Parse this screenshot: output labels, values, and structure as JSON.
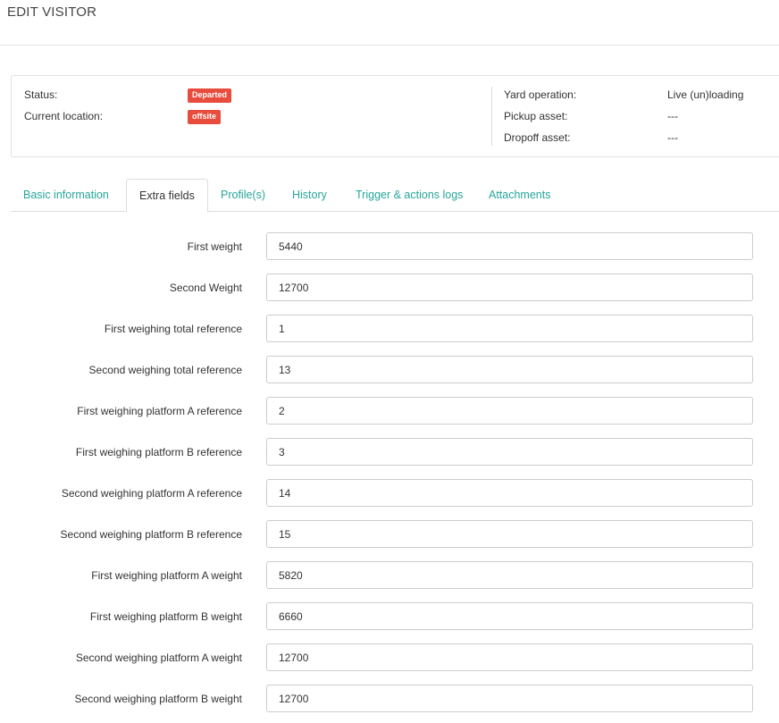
{
  "page": {
    "title": "EDIT VISITOR"
  },
  "status_card": {
    "left": [
      {
        "label": "Status:",
        "value": "Departed",
        "badge_color": "#e74c3c"
      },
      {
        "label": "Current location:",
        "value": "offsite",
        "badge_color": "#e74c3c"
      }
    ],
    "right": [
      {
        "label": "Yard operation:",
        "value": "Live (un)loading"
      },
      {
        "label": "Pickup asset:",
        "value": "---"
      },
      {
        "label": "Dropoff asset:",
        "value": "---"
      }
    ]
  },
  "tabs": [
    {
      "label": "Basic information",
      "active": false
    },
    {
      "label": "Extra fields",
      "active": true
    },
    {
      "label": "Profile(s)",
      "active": false
    },
    {
      "label": "History",
      "active": false
    },
    {
      "label": "Trigger & actions logs",
      "active": false
    },
    {
      "label": "Attachments",
      "active": false
    }
  ],
  "fields": [
    {
      "label": "First weight",
      "value": "5440"
    },
    {
      "label": "Second Weight",
      "value": "12700"
    },
    {
      "label": "First weighing total reference",
      "value": "1"
    },
    {
      "label": "Second weighing total reference",
      "value": "13"
    },
    {
      "label": "First weighing platform A reference",
      "value": "2"
    },
    {
      "label": "First weighing platform B reference",
      "value": "3"
    },
    {
      "label": "Second weighing platform A reference",
      "value": "14"
    },
    {
      "label": "Second weighing platform B reference",
      "value": "15"
    },
    {
      "label": "First weighing platform A weight",
      "value": "5820"
    },
    {
      "label": "First weighing platform B weight",
      "value": "6660"
    },
    {
      "label": "Second weighing platform A weight",
      "value": "12700"
    },
    {
      "label": "Second weighing platform B weight",
      "value": "12700"
    }
  ],
  "colors": {
    "accent": "#26a69a",
    "danger": "#e74c3c"
  }
}
